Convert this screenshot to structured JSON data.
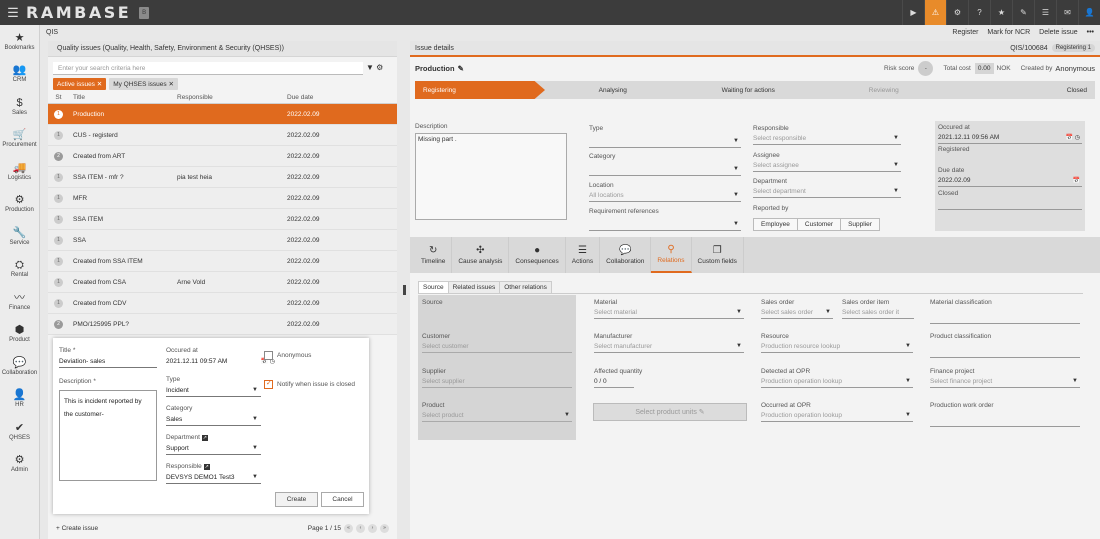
{
  "app": {
    "name": "RAMBASE",
    "logo_badge": "B"
  },
  "top_icons": [
    "play-icon",
    "warning-icon",
    "gear-icon",
    "help-icon",
    "star-icon",
    "link-icon",
    "list-icon",
    "mail-icon",
    "user-icon"
  ],
  "sidebar": [
    {
      "label": "Bookmarks",
      "icon": "★"
    },
    {
      "label": "CRM",
      "icon": "👥"
    },
    {
      "label": "Sales",
      "icon": "$"
    },
    {
      "label": "Procurement",
      "icon": "🛒"
    },
    {
      "label": "Logistics",
      "icon": "🚚"
    },
    {
      "label": "Production",
      "icon": "⚙"
    },
    {
      "label": "Service",
      "icon": "🔧"
    },
    {
      "label": "Rental",
      "icon": "⛭"
    },
    {
      "label": "Finance",
      "icon": "〰"
    },
    {
      "label": "Product",
      "icon": "⬢"
    },
    {
      "label": "Collaboration",
      "icon": "💬"
    },
    {
      "label": "HR",
      "icon": "👤"
    },
    {
      "label": "QHSES",
      "icon": "✔"
    },
    {
      "label": "Admin",
      "icon": "⚙"
    }
  ],
  "crumb": "QIS",
  "top_actions": {
    "register": "Register",
    "mark_ncr": "Mark for NCR",
    "delete": "Delete issue",
    "more": "•••"
  },
  "left": {
    "title": "Quality issues (Quality, Health, Safety, Environment & Security (QHSES))",
    "search_placeholder": "Enter your search criteria here",
    "chips": {
      "active": "Active issues ✕",
      "mine": "My QHSES issues ✕"
    },
    "columns": {
      "st": "St",
      "title": "Title",
      "responsible": "Responsible",
      "due": "Due date"
    },
    "rows": [
      {
        "st": "1",
        "title": "Production",
        "resp": "",
        "due": "2022.02.09"
      },
      {
        "st": "1",
        "title": "CUS - registerd",
        "resp": "",
        "due": "2022.02.09"
      },
      {
        "st": "2",
        "title": "Created from ART",
        "resp": "",
        "due": "2022.02.09"
      },
      {
        "st": "1",
        "title": "SSA ITEM - mfr ?",
        "resp": "pia test heia",
        "due": "2022.02.09"
      },
      {
        "st": "1",
        "title": "MFR",
        "resp": "",
        "due": "2022.02.09"
      },
      {
        "st": "1",
        "title": "SSA ITEM",
        "resp": "",
        "due": "2022.02.09"
      },
      {
        "st": "1",
        "title": "SSA",
        "resp": "",
        "due": "2022.02.09"
      },
      {
        "st": "1",
        "title": "Created from SSA ITEM",
        "resp": "",
        "due": "2022.02.09"
      },
      {
        "st": "1",
        "title": "Created from CSA",
        "resp": "Arne Vold",
        "due": "2022.02.09"
      },
      {
        "st": "1",
        "title": "Created from CDV",
        "resp": "",
        "due": "2022.02.09"
      },
      {
        "st": "2",
        "title": "PMO/125995 PPL?",
        "resp": "",
        "due": "2022.02.09"
      }
    ],
    "create_issue": "+ Create issue",
    "page_info": "Page 1 / 15"
  },
  "right": {
    "header": "Issue details",
    "issue_id": "QIS/100684",
    "status_badge": "Registering",
    "status_count": "1",
    "product_title": "Production",
    "risk_label": "Risk score",
    "risk_value": "-",
    "total_cost_label": "Total cost",
    "total_cost_value": "0.00",
    "currency": "NOK",
    "created_by": "Created by",
    "created_by_name": "Anonymous",
    "steps": [
      "Registering",
      "Analysing",
      "Waiting for actions",
      "Reviewing",
      "Closed"
    ],
    "description_label": "Description",
    "description_value": "Missing part .",
    "type_label": "Type",
    "category_label": "Category",
    "location_label": "Location",
    "location_value": "All locations",
    "reqref_label": "Requirement references",
    "responsible_label": "Responsible",
    "responsible_ph": "Select responsible",
    "assignee_label": "Assignee",
    "assignee_ph": "Select assignee",
    "department_label": "Department",
    "department_ph": "Select department",
    "reported_by_label": "Reported by",
    "reported_by_options": [
      "Employee",
      "Customer",
      "Supplier"
    ],
    "occured_label": "Occured at",
    "occured_value": "2021.12.11 09:56 AM",
    "registered_label": "Registered",
    "due_label": "Due date",
    "due_value": "2022.02.09",
    "closed_label": "Closed",
    "tabs": [
      {
        "label": "Timeline",
        "icon": "↻"
      },
      {
        "label": "Cause analysis",
        "icon": "✣"
      },
      {
        "label": "Consequences",
        "icon": "●"
      },
      {
        "label": "Actions",
        "icon": "☰"
      },
      {
        "label": "Collaboration",
        "icon": "💬"
      },
      {
        "label": "Relations",
        "icon": "⚲"
      },
      {
        "label": "Custom fields",
        "icon": "❐"
      }
    ],
    "subtabs": [
      "Source",
      "Related issues",
      "Other relations"
    ],
    "relations": {
      "source": "Source",
      "customer": "Customer",
      "customer_ph": "Select customer",
      "supplier": "Supplier",
      "supplier_ph": "Select supplier",
      "product": "Product",
      "product_ph": "Select product",
      "material": "Material",
      "material_ph": "Select material",
      "manufacturer": "Manufacturer",
      "manufacturer_ph": "Select manufacturer",
      "affected_qty": "Affected quantity",
      "affected_qty_value": "0 / 0",
      "product_units_btn": "Select product units",
      "sales_order": "Sales order",
      "sales_order_ph": "Select sales order",
      "sales_order_item": "Sales order item",
      "sales_order_item_ph": "Select sales order it",
      "resource": "Resource",
      "resource_ph": "Production resource lookup",
      "detected_opr": "Detected at OPR",
      "detected_opr_ph": "Production operation lookup",
      "occurred_opr": "Occurred at OPR",
      "occurred_opr_ph": "Production operation lookup",
      "material_class": "Material classification",
      "product_class": "Product classification",
      "finance_project": "Finance project",
      "finance_project_ph": "Select finance project",
      "prod_work_order": "Production work order"
    }
  },
  "modal": {
    "title_label": "Title *",
    "title_value": "Deviation- sales",
    "occured_label": "Occured at",
    "occured_value": "2021.12.11 09:57 AM",
    "anonymous_label": "Anonymous",
    "description_label": "Description *",
    "description_value": "This is incident reported by the customer-",
    "type_label": "Type",
    "type_value": "Incident",
    "notify_label": "Notify when issue is closed",
    "category_label": "Category",
    "category_value": "Sales",
    "department_label": "Department",
    "department_value": "Support",
    "responsible_label": "Responsible",
    "responsible_value": "DEVSYS DEMO1 Test3",
    "create_btn": "Create",
    "cancel_btn": "Cancel"
  }
}
